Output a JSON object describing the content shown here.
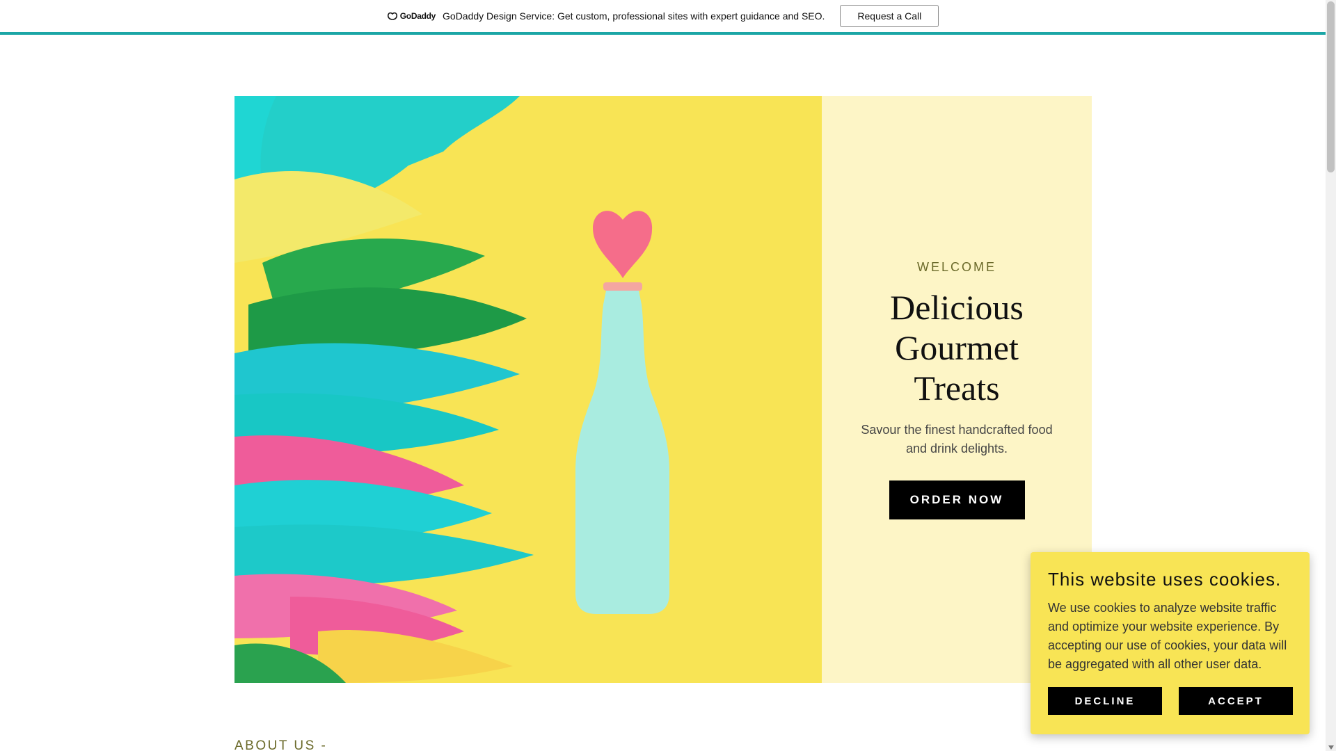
{
  "promo": {
    "logo_text": "GoDaddy",
    "message": "GoDaddy Design Service: Get custom, professional sites with expert guidance and SEO.",
    "cta_label": "Request a Call",
    "accent_color": "#1ba6a6"
  },
  "hero": {
    "eyebrow": "WELCOME",
    "title": "Delicious Gourmet Treats",
    "subtitle": "Savour the finest handcrafted food and drink delights.",
    "cta_label": "ORDER NOW",
    "panel_color": "#fdf5c6",
    "image_bg_color": "#f8e455"
  },
  "about": {
    "label": "ABOUT US -"
  },
  "cookie": {
    "title": "This website uses cookies.",
    "body": "We use cookies to analyze website traffic and optimize your website experience. By accepting our use of cookies, your data will be aggregated with all other user data.",
    "decline_label": "DECLINE",
    "accept_label": "ACCEPT",
    "bg_color": "#f8e455"
  }
}
